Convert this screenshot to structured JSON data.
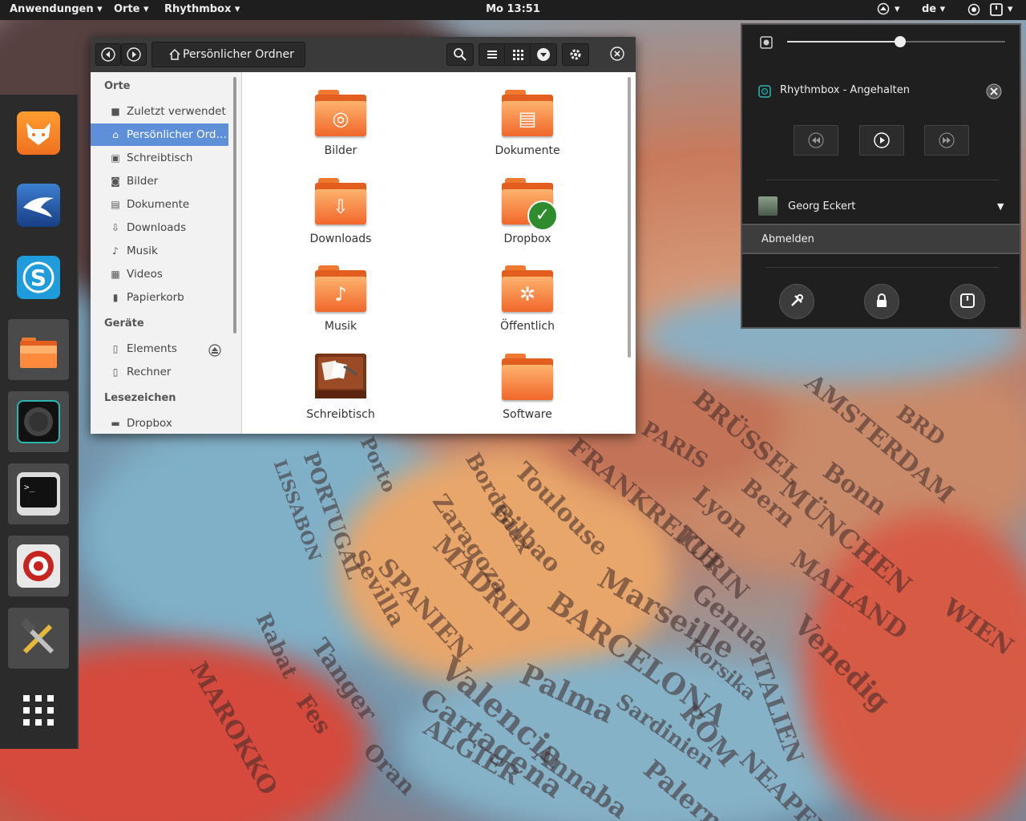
{
  "topbar": {
    "applications": "Anwendungen ▾",
    "places": "Orte ▾",
    "app": "Rhythmbox ▾",
    "clock": "Mo 13:51",
    "keyboard": "de ▾",
    "arrow": "▾"
  },
  "dock": {
    "items": [
      "fox-app-icon",
      "bird-app-icon",
      "skype-icon",
      "files-icon",
      "speaker-icon",
      "terminal-icon",
      "settings-gear-icon",
      "tools-icon",
      "apps-grid-icon"
    ]
  },
  "filemanager": {
    "path": "Persönlicher Ordner",
    "sidebar": {
      "places_header": "Orte",
      "places": [
        {
          "label": "Zuletzt verwendet",
          "icon": "■"
        },
        {
          "label": "Persönlicher Ord…",
          "icon": "⌂"
        },
        {
          "label": "Schreibtisch",
          "icon": "▣"
        },
        {
          "label": "Bilder",
          "icon": "◙"
        },
        {
          "label": "Dokumente",
          "icon": "▤"
        },
        {
          "label": "Downloads",
          "icon": "⇩"
        },
        {
          "label": "Musik",
          "icon": "♪"
        },
        {
          "label": "Videos",
          "icon": "▦"
        },
        {
          "label": "Papierkorb",
          "icon": "▮"
        }
      ],
      "devices_header": "Geräte",
      "devices": [
        {
          "label": "Elements",
          "icon": "▯"
        },
        {
          "label": "Rechner",
          "icon": "▯"
        }
      ],
      "bookmarks_header": "Lesezeichen",
      "bookmarks": [
        {
          "label": "Dropbox",
          "icon": "▬"
        }
      ]
    },
    "folders": [
      {
        "label": "Bilder",
        "glyph": "◎"
      },
      {
        "label": "Dokumente",
        "glyph": "▤"
      },
      {
        "label": "Downloads",
        "glyph": "⇩"
      },
      {
        "label": "Dropbox",
        "glyph": ""
      },
      {
        "label": "Musik",
        "glyph": "♪"
      },
      {
        "label": "Öffentlich",
        "glyph": "✲"
      },
      {
        "label": "Schreibtisch",
        "glyph": ""
      },
      {
        "label": "Software",
        "glyph": ""
      }
    ],
    "check_glyph": "✓"
  },
  "menu": {
    "volume_level": 0.52,
    "player": "Rhythmbox - Angehalten",
    "user": "Georg Eckert",
    "logout": "Abmelden",
    "expand": "▼"
  },
  "wallpaper_labels": [
    "PARIS",
    "FRANKREICH",
    "SPANIEN",
    "MADRID",
    "BARCELONA",
    "Marseille",
    "Genua",
    "Venedig",
    "ITALIEN",
    "ROM",
    "Palma",
    "Valencia",
    "Cartagena",
    "ALGIER",
    "MAROKKO",
    "Bilbao",
    "Zaragoza",
    "Toulouse",
    "Lyon",
    "TURIN",
    "MAILAND",
    "WIEN",
    "MÜNCHEN",
    "Bonn",
    "AMSTERDAM",
    "BRÜSSEL",
    "Bern",
    "Korsika",
    "Sardinien",
    "Tanger",
    "Rabat",
    "Oran",
    "Annaba",
    "Sevilla",
    "Fes",
    "PORTUGAL",
    "LISSABON",
    "NEAPEL",
    "Palermo",
    "BRD",
    "Porto",
    "Bordeaux"
  ]
}
